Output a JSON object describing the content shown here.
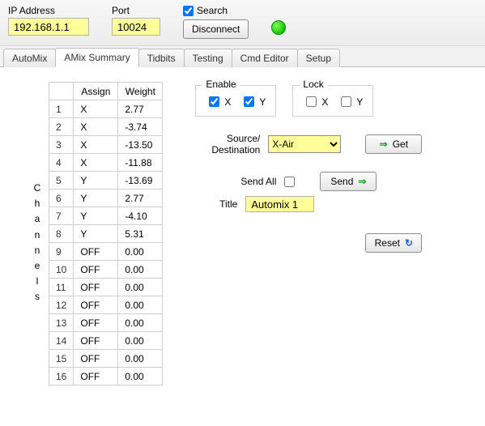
{
  "top": {
    "ip_label": "IP Address",
    "ip_value": "192.168.1.1",
    "port_label": "Port",
    "port_value": "10024",
    "search_label": "Search",
    "search_checked": true,
    "disconnect_label": "Disconnect",
    "status": "connected"
  },
  "tabs": [
    {
      "label": "AutoMix",
      "active": false
    },
    {
      "label": "AMix Summary",
      "active": true
    },
    {
      "label": "Tidbits",
      "active": false
    },
    {
      "label": "Testing",
      "active": false
    },
    {
      "label": "Cmd Editor",
      "active": false
    },
    {
      "label": "Setup",
      "active": false
    }
  ],
  "channels_label": "Channels",
  "grid": {
    "headers": {
      "idx": "",
      "assign": "Assign",
      "weight": "Weight"
    },
    "rows": [
      {
        "idx": "1",
        "assign": "X",
        "weight": "2.77"
      },
      {
        "idx": "2",
        "assign": "X",
        "weight": "-3.74"
      },
      {
        "idx": "3",
        "assign": "X",
        "weight": "-13.50"
      },
      {
        "idx": "4",
        "assign": "X",
        "weight": "-11.88"
      },
      {
        "idx": "5",
        "assign": "Y",
        "weight": "-13.69"
      },
      {
        "idx": "6",
        "assign": "Y",
        "weight": "2.77"
      },
      {
        "idx": "7",
        "assign": "Y",
        "weight": "-4.10"
      },
      {
        "idx": "8",
        "assign": "Y",
        "weight": "5.31"
      },
      {
        "idx": "9",
        "assign": "OFF",
        "weight": "0.00"
      },
      {
        "idx": "10",
        "assign": "OFF",
        "weight": "0.00"
      },
      {
        "idx": "11",
        "assign": "OFF",
        "weight": "0.00"
      },
      {
        "idx": "12",
        "assign": "OFF",
        "weight": "0.00"
      },
      {
        "idx": "13",
        "assign": "OFF",
        "weight": "0.00"
      },
      {
        "idx": "14",
        "assign": "OFF",
        "weight": "0.00"
      },
      {
        "idx": "15",
        "assign": "OFF",
        "weight": "0.00"
      },
      {
        "idx": "16",
        "assign": "OFF",
        "weight": "0.00"
      }
    ]
  },
  "right": {
    "enable_label": "Enable",
    "lock_label": "Lock",
    "x_label": "X",
    "y_label": "Y",
    "enable_x": true,
    "enable_y": true,
    "lock_x": false,
    "lock_y": false,
    "srcdest_label": "Source/\nDestination",
    "srcdest_value": "X-Air",
    "get_label": "Get",
    "sendall_label": "Send All",
    "sendall_checked": false,
    "send_label": "Send",
    "title_label": "Title",
    "title_value": "Automix 1",
    "reset_label": "Reset"
  }
}
